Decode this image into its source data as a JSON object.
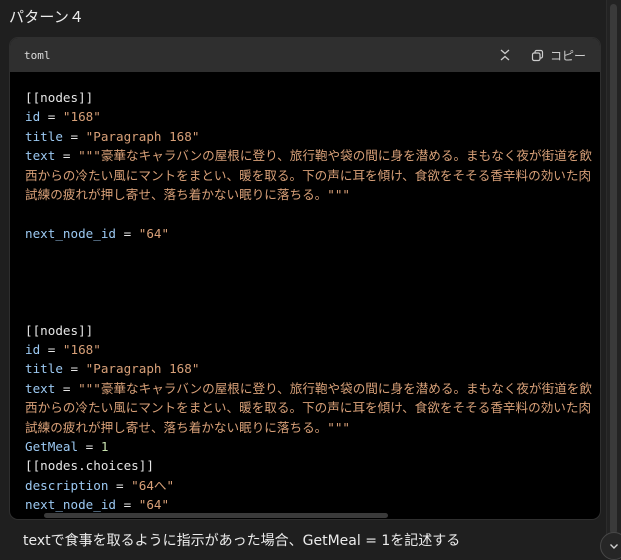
{
  "heading": "パターン４",
  "code_block": {
    "language": "toml",
    "copy_label": "コピー",
    "lines": [
      {
        "tokens": [
          {
            "t": "p",
            "v": "[[nodes]]"
          }
        ]
      },
      {
        "tokens": [
          {
            "t": "k",
            "v": "id"
          },
          {
            "t": "p",
            "v": " = "
          },
          {
            "t": "s",
            "v": "\"168\""
          }
        ]
      },
      {
        "tokens": [
          {
            "t": "k",
            "v": "title"
          },
          {
            "t": "p",
            "v": " = "
          },
          {
            "t": "s",
            "v": "\"Paragraph 168\""
          }
        ]
      },
      {
        "tokens": [
          {
            "t": "k",
            "v": "text"
          },
          {
            "t": "p",
            "v": " = "
          },
          {
            "t": "s",
            "v": "\"\"\"豪華なキャラバンの屋根に登り、旅行鞄や袋の間に身を潜める。まもなく夜が街道を飲"
          }
        ]
      },
      {
        "tokens": [
          {
            "t": "s",
            "v": "西からの冷たい風にマントをまとい、暖を取る。下の声に耳を傾け、食欲をそそる香辛料の効いた肉"
          }
        ]
      },
      {
        "tokens": [
          {
            "t": "s",
            "v": "試練の疲れが押し寄せ、落ち着かない眠りに落ちる。\"\"\""
          }
        ]
      },
      {
        "tokens": []
      },
      {
        "tokens": [
          {
            "t": "k",
            "v": "next_node_id"
          },
          {
            "t": "p",
            "v": " = "
          },
          {
            "t": "s",
            "v": "\"64\""
          }
        ]
      },
      {
        "tokens": []
      },
      {
        "tokens": []
      },
      {
        "tokens": []
      },
      {
        "tokens": []
      },
      {
        "tokens": [
          {
            "t": "p",
            "v": "[[nodes]]"
          }
        ]
      },
      {
        "tokens": [
          {
            "t": "k",
            "v": "id"
          },
          {
            "t": "p",
            "v": " = "
          },
          {
            "t": "s",
            "v": "\"168\""
          }
        ]
      },
      {
        "tokens": [
          {
            "t": "k",
            "v": "title"
          },
          {
            "t": "p",
            "v": " = "
          },
          {
            "t": "s",
            "v": "\"Paragraph 168\""
          }
        ]
      },
      {
        "tokens": [
          {
            "t": "k",
            "v": "text"
          },
          {
            "t": "p",
            "v": " = "
          },
          {
            "t": "s",
            "v": "\"\"\"豪華なキャラバンの屋根に登り、旅行鞄や袋の間に身を潜める。まもなく夜が街道を飲"
          }
        ]
      },
      {
        "tokens": [
          {
            "t": "s",
            "v": "西からの冷たい風にマントをまとい、暖を取る。下の声に耳を傾け、食欲をそそる香辛料の効いた肉"
          }
        ]
      },
      {
        "tokens": [
          {
            "t": "s",
            "v": "試練の疲れが押し寄せ、落ち着かない眠りに落ちる。\"\"\""
          }
        ]
      },
      {
        "tokens": [
          {
            "t": "k",
            "v": "GetMeal"
          },
          {
            "t": "p",
            "v": " = "
          },
          {
            "t": "n",
            "v": "1"
          }
        ]
      },
      {
        "tokens": [
          {
            "t": "p",
            "v": "[[nodes.choices]]"
          }
        ]
      },
      {
        "tokens": [
          {
            "t": "k",
            "v": "description"
          },
          {
            "t": "p",
            "v": " = "
          },
          {
            "t": "s",
            "v": "\"64へ\""
          }
        ]
      },
      {
        "tokens": [
          {
            "t": "k",
            "v": "next_node_id"
          },
          {
            "t": "p",
            "v": " = "
          },
          {
            "t": "s",
            "v": "\"64\""
          }
        ]
      }
    ]
  },
  "footer_text": "textで食事を取るように指示があった場合、GetMeal = 1を記述する",
  "icons": {
    "collapse": "collapse-icon",
    "copy": "copy-icon",
    "scroll_down": "chevron-down-icon"
  },
  "colors": {
    "background": "#1f1f1f",
    "code_background": "#000000",
    "header_background": "#2f2f2f",
    "key": "#9cc9f2",
    "string": "#d8a078",
    "number": "#c9e3b0"
  }
}
